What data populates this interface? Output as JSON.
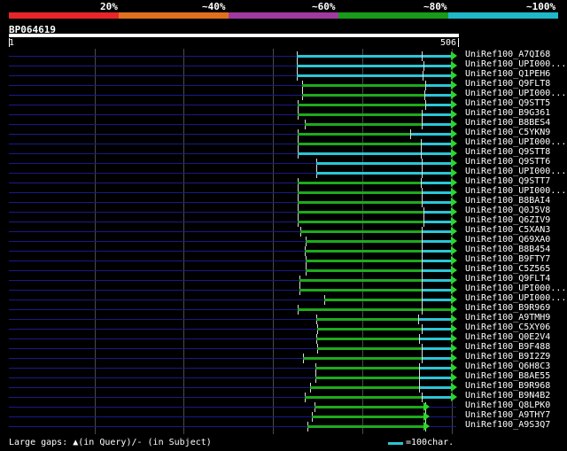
{
  "legend": {
    "segments": [
      {
        "color": "#e8262a"
      },
      {
        "color": "#e07020"
      },
      {
        "color": "#a13aa0"
      },
      {
        "color": "#1a9a1a"
      },
      {
        "color": "#1fb8c8"
      }
    ],
    "labels": [
      "20%",
      "~40%",
      "~60%",
      "~80%",
      "~100%"
    ]
  },
  "query": {
    "name": "BP064619",
    "start": "1",
    "end": "506"
  },
  "hits": [
    {
      "label": "UniRef100_A7QI68"
    },
    {
      "label": "UniRef100_UPI000..."
    },
    {
      "label": "UniRef100_Q1PEH6"
    },
    {
      "label": "UniRef100_Q9FLT8"
    },
    {
      "label": "UniRef100_UPI000..."
    },
    {
      "label": "UniRef100_Q9STT5"
    },
    {
      "label": "UniRef100_B9G361"
    },
    {
      "label": "UniRef100_B8BES4"
    },
    {
      "label": "UniRef100_C5YKN9"
    },
    {
      "label": "UniRef100_UPI000..."
    },
    {
      "label": "UniRef100_Q9STT8"
    },
    {
      "label": "UniRef100_Q9STT6"
    },
    {
      "label": "UniRef100_UPI000..."
    },
    {
      "label": "UniRef100_Q9STT7"
    },
    {
      "label": "UniRef100_UPI000..."
    },
    {
      "label": "UniRef100_B8BAI4"
    },
    {
      "label": "UniRef100_Q0J5V8"
    },
    {
      "label": "UniRef100_Q6ZIV9"
    },
    {
      "label": "UniRef100_C5XAN3"
    },
    {
      "label": "UniRef100_Q69XA0"
    },
    {
      "label": "UniRef100_B8B454"
    },
    {
      "label": "UniRef100_B9FTY7"
    },
    {
      "label": "UniRef100_C5Z565"
    },
    {
      "label": "UniRef100_Q9FLT4"
    },
    {
      "label": "UniRef100_UPI000..."
    },
    {
      "label": "UniRef100_UPI000..."
    },
    {
      "label": "UniRef100_B9R969"
    },
    {
      "label": "UniRef100_A9TMH9"
    },
    {
      "label": "UniRef100_C5XY06"
    },
    {
      "label": "UniRef100_Q0E2V4"
    },
    {
      "label": "UniRef100_B9F488"
    },
    {
      "label": "UniRef100_B9I2Z9"
    },
    {
      "label": "UniRef100_Q6H8C3"
    },
    {
      "label": "UniRef100_B8AE55"
    },
    {
      "label": "UniRef100_B9R968"
    },
    {
      "label": "UniRef100_B9N4B2"
    },
    {
      "label": "UniRef100_Q8LPK0"
    },
    {
      "label": "UniRef100_A9THY7"
    },
    {
      "label": "UniRef100_A9S3Q7"
    }
  ],
  "footer": {
    "gaps_text": "Large gaps: ▲(in Query)/- (in Subject)",
    "scale_text": "=100char."
  }
}
